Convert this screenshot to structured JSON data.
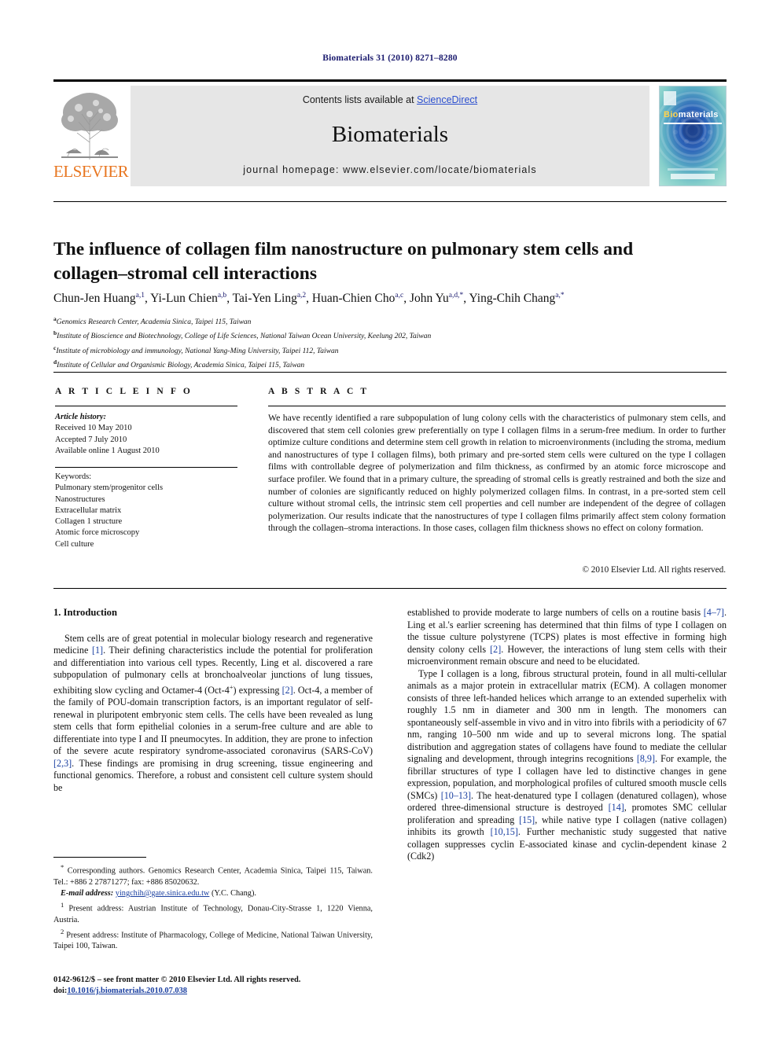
{
  "running_head": "Biomaterials 31 (2010) 8271–8280",
  "masthead": {
    "contents_prefix": "Contents lists available at ",
    "sciencedirect": "ScienceDirect",
    "journal_name": "Biomaterials",
    "homepage": "journal homepage: www.elsevier.com/locate/biomaterials",
    "publisher_logo_text": "ELSEVIER",
    "cover_title_part1": "Bio",
    "cover_title_part2": "materials",
    "sciencedirect_color": "#2b4fcf",
    "elsevier_orange": "#E87722"
  },
  "article": {
    "title": "The influence of collagen film nanostructure on pulmonary stem cells and collagen–stromal cell interactions",
    "authors": [
      {
        "name": "Chun-Jen Huang",
        "sup": "a,1",
        "sep": ", "
      },
      {
        "name": "Yi-Lun Chien",
        "sup": "a,b",
        "sep": ", "
      },
      {
        "name": "Tai-Yen Ling",
        "sup": "a,2",
        "sep": ", "
      },
      {
        "name": "Huan-Chien Cho",
        "sup": "a,c",
        "sep": ", "
      },
      {
        "name": "John Yu",
        "sup": "a,d,*",
        "sep": ", "
      },
      {
        "name": "Ying-Chih Chang",
        "sup": "a,*",
        "sep": ""
      }
    ],
    "affiliations": [
      {
        "mark": "a",
        "text": "Genomics Research Center, Academia Sinica, Taipei 115, Taiwan"
      },
      {
        "mark": "b",
        "text": "Institute of Bioscience and Biotechnology, College of Life Sciences, National Taiwan Ocean University, Keelung 202, Taiwan"
      },
      {
        "mark": "c",
        "text": "Institute of microbiology and immunology, National Yang-Ming University, Taipei 112, Taiwan"
      },
      {
        "mark": "d",
        "text": "Institute of Cellular and Organismic Biology, Academia Sinica, Taipei 115, Taiwan"
      }
    ]
  },
  "article_info": {
    "heading": "A R T I C L E   I N F O",
    "history_label": "Article history:",
    "history": [
      "Received 10 May 2010",
      "Accepted 7 July 2010",
      "Available online 1 August 2010"
    ],
    "keywords_label": "Keywords:",
    "keywords": [
      "Pulmonary stem/progenitor cells",
      "Nanostructures",
      "Extracellular matrix",
      "Collagen 1 structure",
      "Atomic force microscopy",
      "Cell culture"
    ]
  },
  "abstract": {
    "heading": "A B S T R A C T",
    "text": "We have recently identified a rare subpopulation of lung colony cells with the characteristics of pulmonary stem cells, and discovered that stem cell colonies grew preferentially on type I collagen films in a serum-free medium. In order to further optimize culture conditions and determine stem cell growth in relation to microenvironments (including the stroma, medium and nanostructures of type I collagen films), both primary and pre-sorted stem cells were cultured on the type I collagen films with controllable degree of polymerization and film thickness, as confirmed by an atomic force microscope and surface profiler. We found that in a primary culture, the spreading of stromal cells is greatly restrained and both the size and number of colonies are significantly reduced on highly polymerized collagen films. In contrast, in a pre-sorted stem cell culture without stromal cells, the intrinsic stem cell properties and cell number are independent of the degree of collagen polymerization. Our results indicate that the nanostructures of type I collagen films primarily affect stem colony formation through the collagen–stroma interactions. In those cases, collagen film thickness shows no effect on colony formation.",
    "copyright": "© 2010 Elsevier Ltd. All rights reserved."
  },
  "introduction": {
    "heading": "1. Introduction",
    "left_para_1_a": "Stem cells are of great potential in molecular biology research and regenerative medicine ",
    "left_ref_1": "[1]",
    "left_para_1_b": ". Their defining characteristics include the potential for proliferation and differentiation into various cell types. Recently, Ling et al. discovered a rare subpopulation of pulmonary cells at bronchoalveolar junctions of lung tissues, exhibiting slow cycling and Octamer-4 (Oct-4",
    "left_sup_plus": "+",
    "left_para_1_c": ") expressing ",
    "left_ref_2": "[2]",
    "left_para_1_d": ". Oct-4, a member of the family of POU-domain transcription factors, is an important regulator of self-renewal in pluripotent embryonic stem cells. The cells have been revealed as lung stem cells that form epithelial colonies in a serum-free culture and are able to differentiate into type I and II pneumocytes. In addition, they are prone to infection of the severe acute respiratory syndrome-associated coronavirus (SARS-CoV) ",
    "left_ref_3": "[2,3]",
    "left_para_1_e": ". These findings are promising in drug screening, tissue engineering and functional genomics. Therefore, a robust and consistent cell culture system should be",
    "right_para_1_a": "established to provide moderate to large numbers of cells on a routine basis ",
    "right_ref_1": "[4–7]",
    "right_para_1_b": ". Ling et al.'s earlier screening has determined that thin films of type I collagen on the tissue culture polystyrene (TCPS) plates is most effective in forming high density colony cells ",
    "right_ref_2": "[2]",
    "right_para_1_c": ". However, the interactions of lung stem cells with their microenvironment remain obscure and need to be elucidated.",
    "right_para_2_a": "Type I collagen is a long, fibrous structural protein, found in all multi-cellular animals as a major protein in extracellular matrix (ECM). A collagen monomer consists of three left-handed helices which arrange to an extended superhelix with roughly 1.5 nm in diameter and 300 nm in length. The monomers can spontaneously self-assemble in vivo and in vitro into fibrils with a periodicity of 67 nm, ranging 10–500 nm wide and up to several microns long. The spatial distribution and aggregation states of collagens have found to mediate the cellular signaling and development, through integrins recognitions ",
    "right_ref_3": "[8,9]",
    "right_para_2_b": ". For example, the fibrillar structures of type I collagen have led to distinctive changes in gene expression, population, and morphological profiles of cultured smooth muscle cells (SMCs) ",
    "right_ref_4": "[10–13]",
    "right_para_2_c": ". The heat-denatured type I collagen (denatured collagen), whose ordered three-dimensional structure is destroyed ",
    "right_ref_5": "[14]",
    "right_para_2_d": ", promotes SMC cellular proliferation and spreading ",
    "right_ref_6": "[15]",
    "right_para_2_e": ", while native type I collagen (native collagen) inhibits its growth ",
    "right_ref_7": "[10,15]",
    "right_para_2_f": ". Further mechanistic study suggested that native collagen suppresses cyclin E-associated kinase and cyclin-dependent kinase 2 (Cdk2)"
  },
  "footnotes": {
    "corresponding_mark": "*",
    "corresponding": " Corresponding authors. Genomics Research Center, Academia Sinica, Taipei 115, Taiwan. Tel.: +886 2 27871277; fax: +886 85020632.",
    "email_label": "E-mail address:",
    "email": "yingchih@gate.sinica.edu.tw",
    "email_suffix": " (Y.C. Chang).",
    "fn1_mark": "1",
    "fn1": " Present address: Austrian Institute of Technology, Donau-City-Strasse 1, 1220 Vienna, Austria.",
    "fn2_mark": "2",
    "fn2": " Present address: Institute of Pharmacology, College of Medicine, National Taiwan University, Taipei 100, Taiwan."
  },
  "footer": {
    "front_matter": "0142-9612/$ – see front matter © 2010 Elsevier Ltd. All rights reserved.",
    "doi_label": "doi:",
    "doi": "10.1016/j.biomaterials.2010.07.038"
  }
}
